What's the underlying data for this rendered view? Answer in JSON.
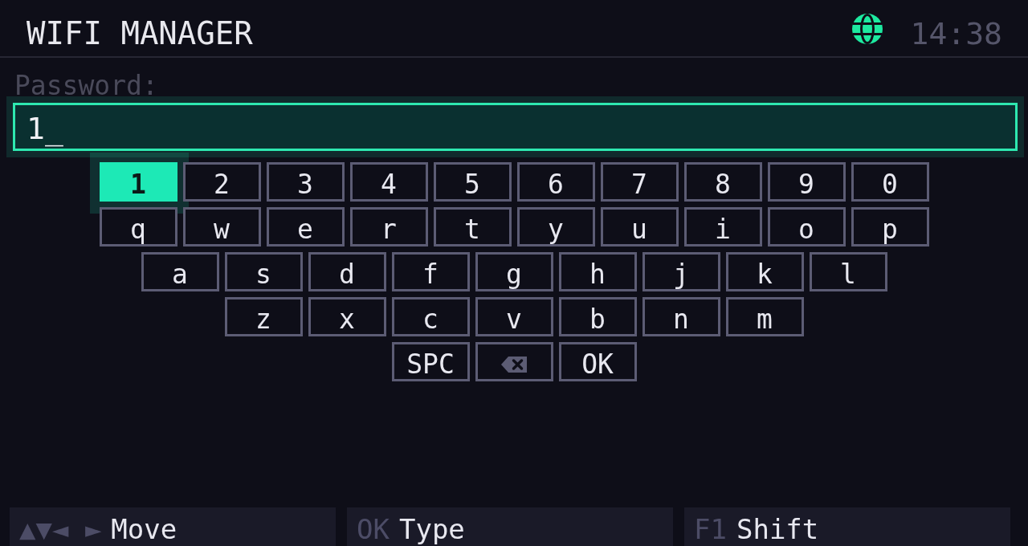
{
  "header": {
    "title": "WIFI MANAGER",
    "time": "14:38"
  },
  "password": {
    "label": "Password:",
    "value": "1_"
  },
  "keyboard": {
    "rows": [
      {
        "keys": [
          {
            "kind": "char",
            "label": "1",
            "selected": true
          },
          {
            "kind": "char",
            "label": "2",
            "selected": false
          },
          {
            "kind": "char",
            "label": "3",
            "selected": false
          },
          {
            "kind": "char",
            "label": "4",
            "selected": false
          },
          {
            "kind": "char",
            "label": "5",
            "selected": false
          },
          {
            "kind": "char",
            "label": "6",
            "selected": false
          },
          {
            "kind": "char",
            "label": "7",
            "selected": false
          },
          {
            "kind": "char",
            "label": "8",
            "selected": false
          },
          {
            "kind": "char",
            "label": "9",
            "selected": false
          },
          {
            "kind": "char",
            "label": "0",
            "selected": false
          }
        ]
      },
      {
        "keys": [
          {
            "kind": "char",
            "label": "q",
            "selected": false
          },
          {
            "kind": "char",
            "label": "w",
            "selected": false
          },
          {
            "kind": "char",
            "label": "e",
            "selected": false
          },
          {
            "kind": "char",
            "label": "r",
            "selected": false
          },
          {
            "kind": "char",
            "label": "t",
            "selected": false
          },
          {
            "kind": "char",
            "label": "y",
            "selected": false
          },
          {
            "kind": "char",
            "label": "u",
            "selected": false
          },
          {
            "kind": "char",
            "label": "i",
            "selected": false
          },
          {
            "kind": "char",
            "label": "o",
            "selected": false
          },
          {
            "kind": "char",
            "label": "p",
            "selected": false
          }
        ]
      },
      {
        "keys": [
          {
            "kind": "char",
            "label": "a",
            "selected": false
          },
          {
            "kind": "char",
            "label": "s",
            "selected": false
          },
          {
            "kind": "char",
            "label": "d",
            "selected": false
          },
          {
            "kind": "char",
            "label": "f",
            "selected": false
          },
          {
            "kind": "char",
            "label": "g",
            "selected": false
          },
          {
            "kind": "char",
            "label": "h",
            "selected": false
          },
          {
            "kind": "char",
            "label": "j",
            "selected": false
          },
          {
            "kind": "char",
            "label": "k",
            "selected": false
          },
          {
            "kind": "char",
            "label": "l",
            "selected": false
          }
        ]
      },
      {
        "keys": [
          {
            "kind": "char",
            "label": "z",
            "selected": false
          },
          {
            "kind": "char",
            "label": "x",
            "selected": false
          },
          {
            "kind": "char",
            "label": "c",
            "selected": false
          },
          {
            "kind": "char",
            "label": "v",
            "selected": false
          },
          {
            "kind": "char",
            "label": "b",
            "selected": false
          },
          {
            "kind": "char",
            "label": "n",
            "selected": false
          },
          {
            "kind": "char",
            "label": "m",
            "selected": false
          }
        ]
      },
      {
        "keys": [
          {
            "kind": "char",
            "label": "SPC",
            "selected": false
          },
          {
            "kind": "backspace",
            "selected": false
          },
          {
            "kind": "char",
            "label": "OK",
            "selected": false
          }
        ]
      }
    ]
  },
  "hints": [
    {
      "keys": "▲▼◄ ►",
      "action": "Move"
    },
    {
      "keys": "OK",
      "action": "Type"
    },
    {
      "keys": "F1",
      "action": "Shift"
    }
  ]
}
